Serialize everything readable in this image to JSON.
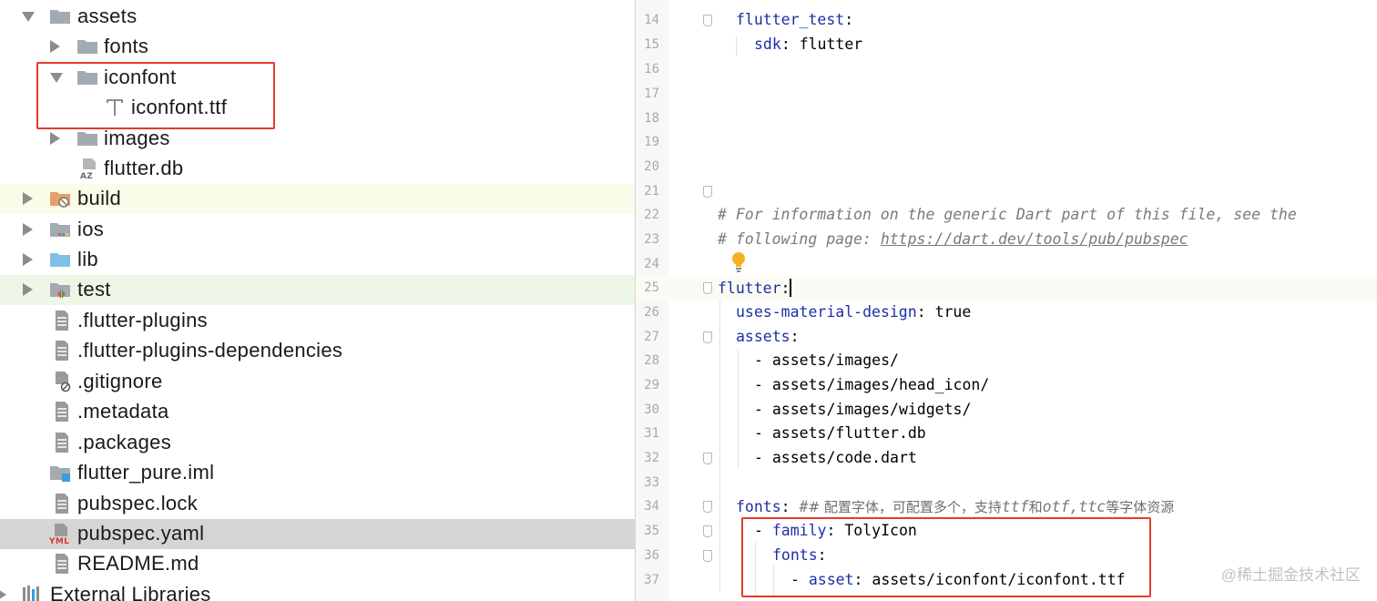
{
  "tree": {
    "items": [
      {
        "label": "assets",
        "icon": "folder-icon",
        "expanded": true
      },
      {
        "label": "fonts",
        "icon": "folder-icon",
        "expanded": false
      },
      {
        "label": "iconfont",
        "icon": "folder-icon",
        "expanded": true
      },
      {
        "label": "iconfont.ttf",
        "icon": "font-file-icon"
      },
      {
        "label": "images",
        "icon": "folder-icon",
        "expanded": false
      },
      {
        "label": "flutter.db",
        "icon": "database-file-icon"
      },
      {
        "label": "build",
        "icon": "excluded-folder-icon",
        "expanded": false
      },
      {
        "label": "ios",
        "icon": "ios-folder-icon",
        "expanded": false
      },
      {
        "label": "lib",
        "icon": "source-folder-icon",
        "expanded": false
      },
      {
        "label": "test",
        "icon": "test-folder-icon",
        "expanded": false
      },
      {
        "label": ".flutter-plugins",
        "icon": "text-file-icon"
      },
      {
        "label": ".flutter-plugins-dependencies",
        "icon": "text-file-icon"
      },
      {
        "label": ".gitignore",
        "icon": "gitignore-file-icon"
      },
      {
        "label": ".metadata",
        "icon": "text-file-icon"
      },
      {
        "label": ".packages",
        "icon": "text-file-icon"
      },
      {
        "label": "flutter_pure.iml",
        "icon": "module-file-icon"
      },
      {
        "label": "pubspec.lock",
        "icon": "text-file-icon"
      },
      {
        "label": "pubspec.yaml",
        "icon": "yaml-file-icon",
        "selected": true
      },
      {
        "label": "README.md",
        "icon": "text-file-icon"
      },
      {
        "label": "External Libraries",
        "icon": "library-icon",
        "expanded": false
      }
    ]
  },
  "editor": {
    "lines": [
      {
        "n": "14",
        "key": "flutter_test"
      },
      {
        "n": "15",
        "key": "sdk",
        "value": "flutter"
      },
      {
        "n": "16"
      },
      {
        "n": "17"
      },
      {
        "n": "18"
      },
      {
        "n": "19"
      },
      {
        "n": "20"
      },
      {
        "n": "21"
      },
      {
        "n": "22",
        "comment": "# For information on the generic Dart part of this file, see the"
      },
      {
        "n": "23",
        "comment": "# following page: ",
        "link": "https://dart.dev/tools/pub/pubspec"
      },
      {
        "n": "24"
      },
      {
        "n": "25",
        "key": "flutter"
      },
      {
        "n": "26",
        "key": "uses-material-design",
        "value": "true"
      },
      {
        "n": "27",
        "key": "assets"
      },
      {
        "n": "28",
        "item": "- assets/images/"
      },
      {
        "n": "29",
        "item": "- assets/images/head_icon/"
      },
      {
        "n": "30",
        "item": "- assets/images/widgets/"
      },
      {
        "n": "31",
        "item": "- assets/flutter.db"
      },
      {
        "n": "32",
        "item": "- assets/code.dart"
      },
      {
        "n": "33"
      },
      {
        "n": "34",
        "key": "fonts",
        "comment_a": "# 配置字体，可配置多个，支持",
        "comment_b": "ttf",
        "comment_c": "和",
        "comment_d": "otf,ttc",
        "comment_e": "等字体资源"
      },
      {
        "n": "35",
        "dash": "- ",
        "key": "family",
        "value": "TolyIcon"
      },
      {
        "n": "36",
        "key": "fonts"
      },
      {
        "n": "37",
        "dash": "- ",
        "key": "asset",
        "value": "assets/iconfont/iconfont.ttf"
      }
    ]
  },
  "watermark": "@稀土掘金技术社区",
  "colors": {
    "highlight_box": "#e43b2c",
    "key": "#1c2fa6",
    "comment": "#7a7a7a",
    "selected_row": "#d5d5d5"
  }
}
